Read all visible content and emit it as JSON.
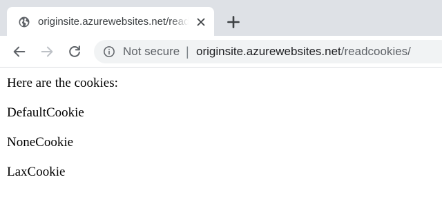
{
  "tab": {
    "title": "originsite.azurewebsites.net/readcookies/",
    "icon": "globe-icon",
    "close_icon": "close-icon"
  },
  "newtab": {
    "icon": "plus-icon"
  },
  "navigation": {
    "back_icon": "back-arrow-icon",
    "forward_icon": "forward-arrow-icon",
    "reload_icon": "reload-icon"
  },
  "omnibox": {
    "info_icon": "info-icon",
    "security_label": "Not secure",
    "separator": "|",
    "url_host": "originsite.azurewebsites.net",
    "url_path": "/readcookies/"
  },
  "page": {
    "heading": "Here are the cookies:",
    "cookies": [
      "DefaultCookie",
      "NoneCookie",
      "LaxCookie"
    ]
  },
  "colors": {
    "tabstrip_bg": "#dee1e6",
    "omnibox_bg": "#f1f3f4",
    "icon_color": "#5f6368"
  }
}
